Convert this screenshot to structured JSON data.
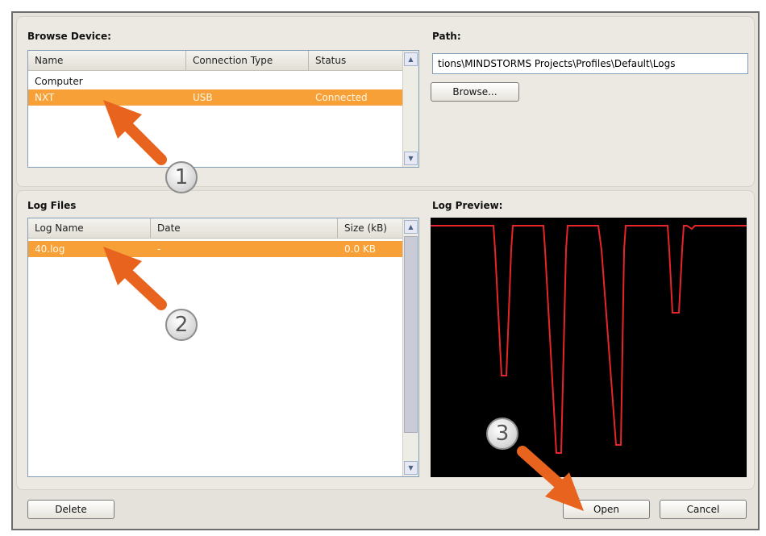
{
  "browse_device": {
    "label": "Browse Device:",
    "columns": [
      "Name",
      "Connection Type",
      "Status"
    ],
    "rows": [
      {
        "name": "Computer",
        "connection": "",
        "status": ""
      },
      {
        "name": "NXT",
        "connection": "USB",
        "status": "Connected",
        "selected": true
      }
    ]
  },
  "path": {
    "label": "Path:",
    "value": "tions\\MINDSTORMS Projects\\Profiles\\Default\\Logs",
    "browse_button": "Browse..."
  },
  "log_files": {
    "label": "Log Files",
    "columns": [
      "Log Name",
      "Date",
      "Size (kB)"
    ],
    "rows": [
      {
        "name": "40.log",
        "date": "-",
        "size": "0.0 KB",
        "selected": true
      }
    ]
  },
  "log_preview": {
    "label": "Log Preview:",
    "line_color": "#e8242b",
    "background": "#000000"
  },
  "buttons": {
    "delete": "Delete",
    "open": "Open",
    "cancel": "Cancel"
  },
  "annotations": {
    "step_1": "1",
    "step_2": "2",
    "step_3": "3",
    "arrow_color": "#e8641e"
  },
  "colors": {
    "selection": "#f7a038",
    "dialog_bg": "#e4e2da"
  }
}
